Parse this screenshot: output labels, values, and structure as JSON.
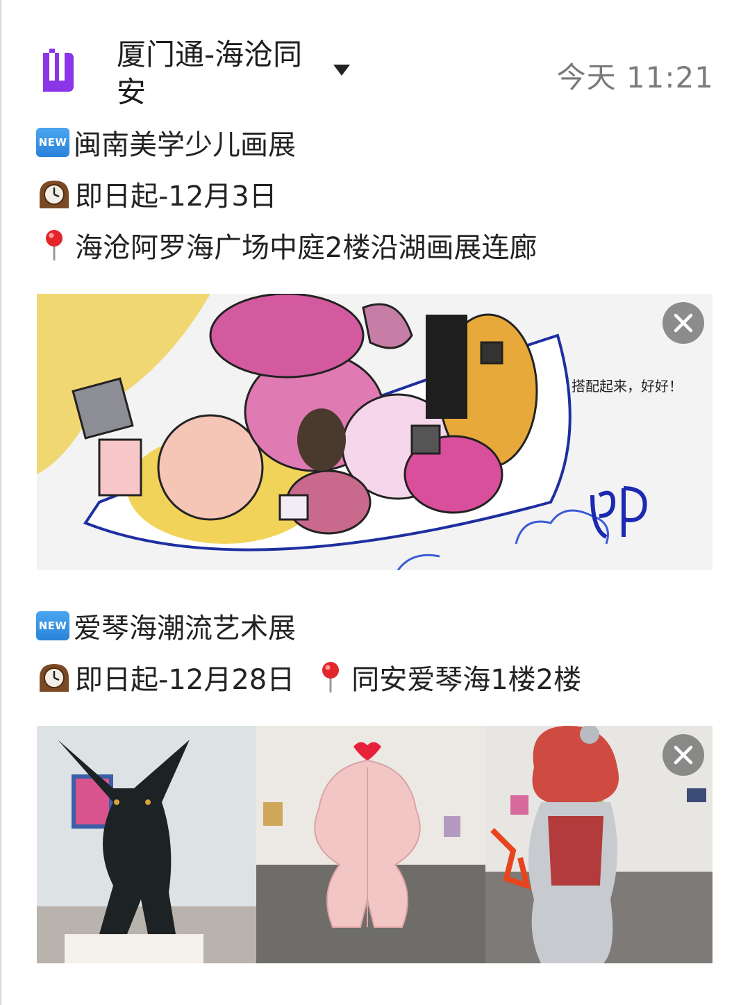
{
  "header": {
    "title": "厦门通-海沧同安",
    "time": "今天 11:21",
    "app_icon": "bookmark-app-icon",
    "dropdown_icon": "triangle-down-icon",
    "accent": "#8a35e6"
  },
  "posts": [
    {
      "badge": "NEW",
      "title": "闽南美学少儿画展",
      "date": "即日起-12月3日",
      "location": "海沧阿罗海广场中庭2楼沿湖画展连廊",
      "image_text": "搭配起来，好好！"
    },
    {
      "badge": "NEW",
      "title": "爱琴海潮流艺术展",
      "date": "即日起-12月28日",
      "location": "同安爱琴海1楼2楼"
    }
  ],
  "icons": {
    "new": "new-badge-icon",
    "clock": "mantel-clock-icon",
    "pin": "round-pushpin-icon",
    "close": "close-icon"
  }
}
